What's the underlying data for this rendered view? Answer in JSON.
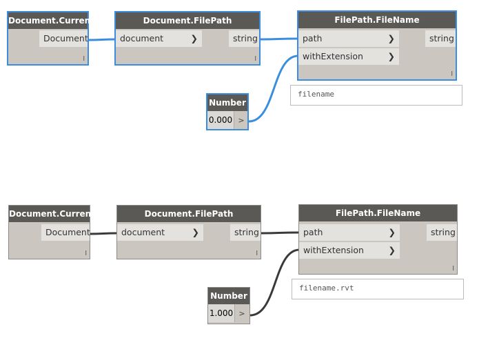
{
  "graphs": [
    {
      "state": "selected",
      "wire_color": "#3b8ede",
      "current": {
        "title": "Document.Current",
        "output": "Document"
      },
      "filepath": {
        "title": "Document.FilePath",
        "input": "document",
        "output": "string"
      },
      "filename": {
        "title": "FilePath.FileName",
        "inputs": [
          "path",
          "withExtension"
        ],
        "output": "string",
        "preview": "filename"
      },
      "number": {
        "title": "Number",
        "value": "0.000",
        "button": ">"
      }
    },
    {
      "state": "normal",
      "wire_color": "#3a3a3a",
      "current": {
        "title": "Document.Current",
        "output": "Document"
      },
      "filepath": {
        "title": "Document.FilePath",
        "input": "document",
        "output": "string"
      },
      "filename": {
        "title": "FilePath.FileName",
        "inputs": [
          "path",
          "withExtension"
        ],
        "output": "string",
        "preview": "filename.rvt"
      },
      "number": {
        "title": "Number",
        "value": "1.000",
        "button": ">"
      }
    }
  ],
  "lacing_symbol": "l"
}
